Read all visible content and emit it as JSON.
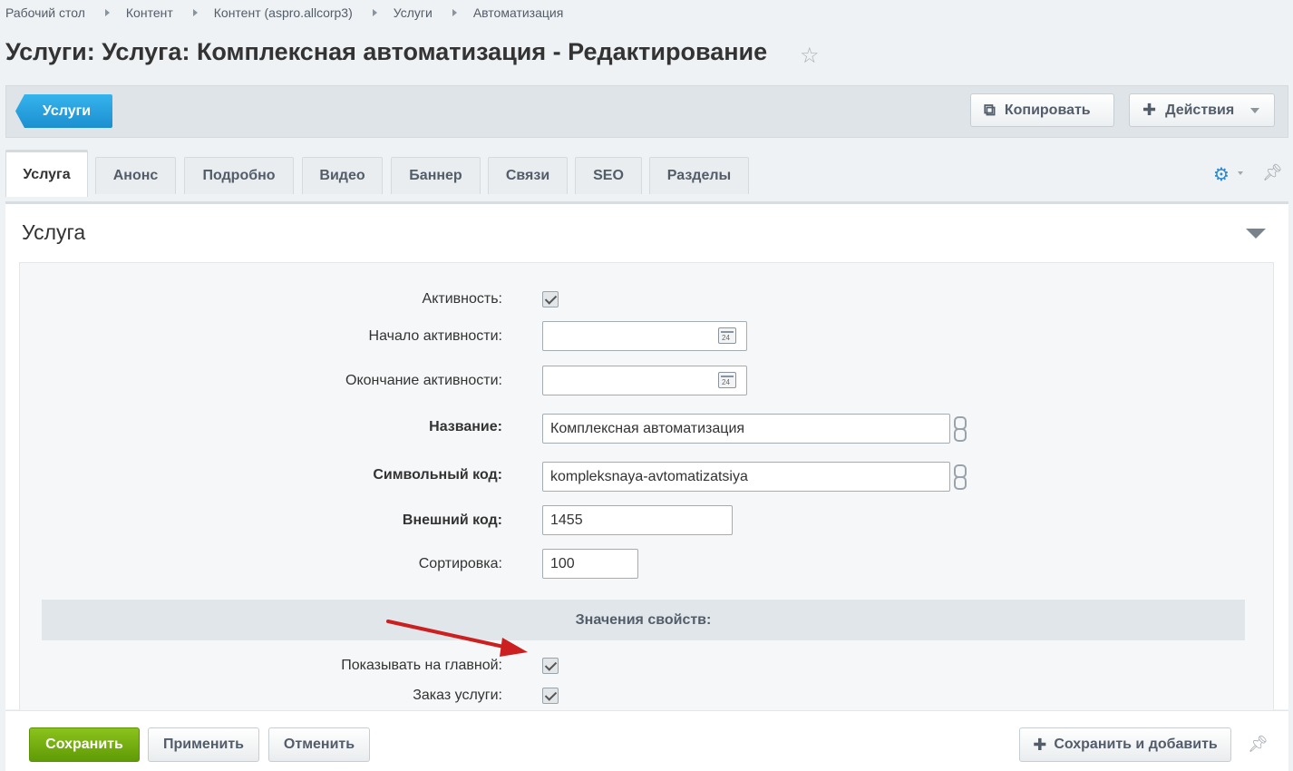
{
  "breadcrumbs": [
    "Рабочий стол",
    "Контент",
    "Контент (aspro.allcorp3)",
    "Услуги",
    "Автоматизация"
  ],
  "page_title": "Услуги: Услуга: Комплексная автоматизация - Редактирование",
  "toolbar": {
    "back_label": "Услуги",
    "copy_label": "Копировать",
    "actions_label": "Действия"
  },
  "tabs": [
    "Услуга",
    "Анонс",
    "Подробно",
    "Видео",
    "Баннер",
    "Связи",
    "SEO",
    "Разделы"
  ],
  "section": {
    "title": "Услуга"
  },
  "form": {
    "active_label": "Активность:",
    "active_checked": true,
    "start_label": "Начало активности:",
    "start_value": "",
    "end_label": "Окончание активности:",
    "end_value": "",
    "calendar_day": "24",
    "name_label": "Название:",
    "name_value": "Комплексная автоматизация",
    "code_label": "Символьный код:",
    "code_value": "kompleksnaya-avtomatizatsiya",
    "ext_label": "Внешний код:",
    "ext_value": "1455",
    "sort_label": "Сортировка:",
    "sort_value": "100",
    "props_header": "Значения свойств:",
    "show_main_label": "Показывать на главной:",
    "show_main_checked": true,
    "order_label": "Заказ услуги:",
    "order_checked": true
  },
  "footer": {
    "save_label": "Сохранить",
    "apply_label": "Применить",
    "cancel_label": "Отменить",
    "save_add_label": "Сохранить и добавить"
  },
  "colors": {
    "accent_blue": "#1c8fd1",
    "save_green": "#6aa60c",
    "annotation_arrow": "#cc1f1f"
  }
}
